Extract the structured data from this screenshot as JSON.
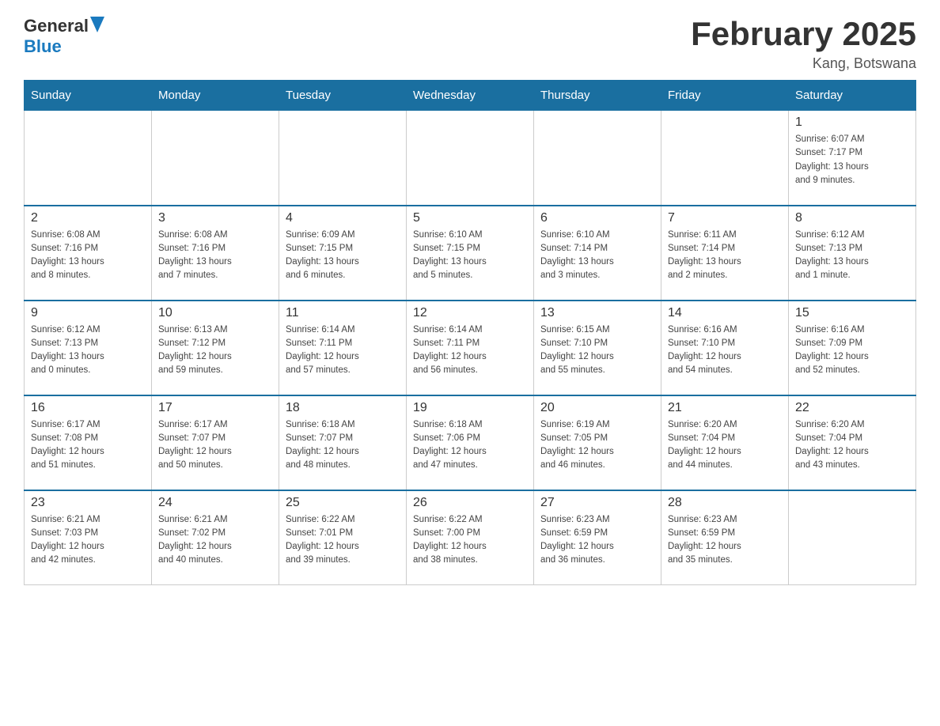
{
  "header": {
    "logo_general": "General",
    "logo_blue": "Blue",
    "month_title": "February 2025",
    "location": "Kang, Botswana"
  },
  "weekdays": [
    "Sunday",
    "Monday",
    "Tuesday",
    "Wednesday",
    "Thursday",
    "Friday",
    "Saturday"
  ],
  "weeks": [
    [
      {
        "day": "",
        "info": ""
      },
      {
        "day": "",
        "info": ""
      },
      {
        "day": "",
        "info": ""
      },
      {
        "day": "",
        "info": ""
      },
      {
        "day": "",
        "info": ""
      },
      {
        "day": "",
        "info": ""
      },
      {
        "day": "1",
        "info": "Sunrise: 6:07 AM\nSunset: 7:17 PM\nDaylight: 13 hours\nand 9 minutes."
      }
    ],
    [
      {
        "day": "2",
        "info": "Sunrise: 6:08 AM\nSunset: 7:16 PM\nDaylight: 13 hours\nand 8 minutes."
      },
      {
        "day": "3",
        "info": "Sunrise: 6:08 AM\nSunset: 7:16 PM\nDaylight: 13 hours\nand 7 minutes."
      },
      {
        "day": "4",
        "info": "Sunrise: 6:09 AM\nSunset: 7:15 PM\nDaylight: 13 hours\nand 6 minutes."
      },
      {
        "day": "5",
        "info": "Sunrise: 6:10 AM\nSunset: 7:15 PM\nDaylight: 13 hours\nand 5 minutes."
      },
      {
        "day": "6",
        "info": "Sunrise: 6:10 AM\nSunset: 7:14 PM\nDaylight: 13 hours\nand 3 minutes."
      },
      {
        "day": "7",
        "info": "Sunrise: 6:11 AM\nSunset: 7:14 PM\nDaylight: 13 hours\nand 2 minutes."
      },
      {
        "day": "8",
        "info": "Sunrise: 6:12 AM\nSunset: 7:13 PM\nDaylight: 13 hours\nand 1 minute."
      }
    ],
    [
      {
        "day": "9",
        "info": "Sunrise: 6:12 AM\nSunset: 7:13 PM\nDaylight: 13 hours\nand 0 minutes."
      },
      {
        "day": "10",
        "info": "Sunrise: 6:13 AM\nSunset: 7:12 PM\nDaylight: 12 hours\nand 59 minutes."
      },
      {
        "day": "11",
        "info": "Sunrise: 6:14 AM\nSunset: 7:11 PM\nDaylight: 12 hours\nand 57 minutes."
      },
      {
        "day": "12",
        "info": "Sunrise: 6:14 AM\nSunset: 7:11 PM\nDaylight: 12 hours\nand 56 minutes."
      },
      {
        "day": "13",
        "info": "Sunrise: 6:15 AM\nSunset: 7:10 PM\nDaylight: 12 hours\nand 55 minutes."
      },
      {
        "day": "14",
        "info": "Sunrise: 6:16 AM\nSunset: 7:10 PM\nDaylight: 12 hours\nand 54 minutes."
      },
      {
        "day": "15",
        "info": "Sunrise: 6:16 AM\nSunset: 7:09 PM\nDaylight: 12 hours\nand 52 minutes."
      }
    ],
    [
      {
        "day": "16",
        "info": "Sunrise: 6:17 AM\nSunset: 7:08 PM\nDaylight: 12 hours\nand 51 minutes."
      },
      {
        "day": "17",
        "info": "Sunrise: 6:17 AM\nSunset: 7:07 PM\nDaylight: 12 hours\nand 50 minutes."
      },
      {
        "day": "18",
        "info": "Sunrise: 6:18 AM\nSunset: 7:07 PM\nDaylight: 12 hours\nand 48 minutes."
      },
      {
        "day": "19",
        "info": "Sunrise: 6:18 AM\nSunset: 7:06 PM\nDaylight: 12 hours\nand 47 minutes."
      },
      {
        "day": "20",
        "info": "Sunrise: 6:19 AM\nSunset: 7:05 PM\nDaylight: 12 hours\nand 46 minutes."
      },
      {
        "day": "21",
        "info": "Sunrise: 6:20 AM\nSunset: 7:04 PM\nDaylight: 12 hours\nand 44 minutes."
      },
      {
        "day": "22",
        "info": "Sunrise: 6:20 AM\nSunset: 7:04 PM\nDaylight: 12 hours\nand 43 minutes."
      }
    ],
    [
      {
        "day": "23",
        "info": "Sunrise: 6:21 AM\nSunset: 7:03 PM\nDaylight: 12 hours\nand 42 minutes."
      },
      {
        "day": "24",
        "info": "Sunrise: 6:21 AM\nSunset: 7:02 PM\nDaylight: 12 hours\nand 40 minutes."
      },
      {
        "day": "25",
        "info": "Sunrise: 6:22 AM\nSunset: 7:01 PM\nDaylight: 12 hours\nand 39 minutes."
      },
      {
        "day": "26",
        "info": "Sunrise: 6:22 AM\nSunset: 7:00 PM\nDaylight: 12 hours\nand 38 minutes."
      },
      {
        "day": "27",
        "info": "Sunrise: 6:23 AM\nSunset: 6:59 PM\nDaylight: 12 hours\nand 36 minutes."
      },
      {
        "day": "28",
        "info": "Sunrise: 6:23 AM\nSunset: 6:59 PM\nDaylight: 12 hours\nand 35 minutes."
      },
      {
        "day": "",
        "info": ""
      }
    ]
  ]
}
